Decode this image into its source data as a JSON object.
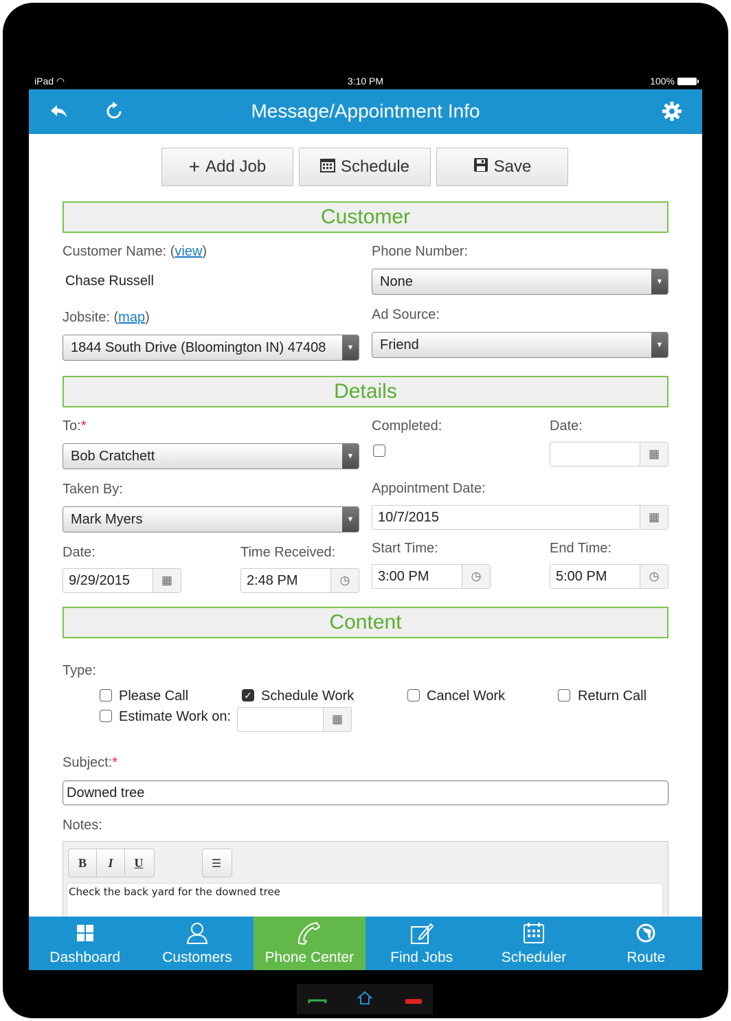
{
  "status_bar": {
    "device": "iPad",
    "time": "3:10 PM",
    "battery": "100%"
  },
  "header": {
    "title": "Message/Appointment Info"
  },
  "toolbar": {
    "add_job": "Add Job",
    "schedule": "Schedule",
    "save": "Save"
  },
  "customer": {
    "section_title": "Customer",
    "name_label": "Customer Name: ",
    "name_link": "view",
    "name_value": "Chase Russell",
    "phone_label": "Phone Number:",
    "phone_value": "None",
    "jobsite_label": "Jobsite: ",
    "jobsite_link": "map",
    "jobsite_value": "1844 South Drive (Bloomington IN) 47408",
    "ad_source_label": "Ad Source:",
    "ad_source_value": "Friend"
  },
  "details": {
    "section_title": "Details",
    "to_label": "To:",
    "to_value": "Bob Cratchett",
    "completed_label": "Completed:",
    "completed_checked": false,
    "date_label": "Date:",
    "date_value": "",
    "taken_by_label": "Taken By:",
    "taken_by_value": "Mark Myers",
    "appointment_date_label": "Appointment Date:",
    "appointment_date_value": "10/7/2015",
    "received_date_label": "Date:",
    "received_date_value": "9/29/2015",
    "time_received_label": "Time Received:",
    "time_received_value": "2:48 PM",
    "start_time_label": "Start Time:",
    "start_time_value": "3:00 PM",
    "end_time_label": "End Time:",
    "end_time_value": "5:00 PM"
  },
  "content": {
    "section_title": "Content",
    "type_label": "Type:",
    "types": [
      {
        "label": "Please Call",
        "checked": false
      },
      {
        "label": "Schedule Work",
        "checked": true
      },
      {
        "label": "Cancel Work",
        "checked": false
      },
      {
        "label": "Return Call",
        "checked": false
      },
      {
        "label": "Estimate Work on:",
        "checked": false
      }
    ],
    "estimate_date_value": "",
    "subject_label": "Subject:",
    "subject_value": "Downed tree",
    "notes_label": "Notes:",
    "editor_buttons": {
      "bold": "B",
      "italic": "I",
      "underline": "U"
    },
    "notes_value": "Check the back yard for the downed tree"
  },
  "tabs": [
    {
      "label": "Dashboard",
      "icon": "dashboard-icon",
      "active": false
    },
    {
      "label": "Customers",
      "icon": "person-icon",
      "active": false
    },
    {
      "label": "Phone Center",
      "icon": "phone-icon",
      "active": true
    },
    {
      "label": "Find Jobs",
      "icon": "edit-icon",
      "active": false
    },
    {
      "label": "Scheduler",
      "icon": "calendar-icon",
      "active": false
    },
    {
      "label": "Route",
      "icon": "globe-icon",
      "active": false
    }
  ],
  "colors": {
    "brand_blue": "#1c93d1",
    "active_green": "#63b84a",
    "section_green": "#5aad2e"
  }
}
